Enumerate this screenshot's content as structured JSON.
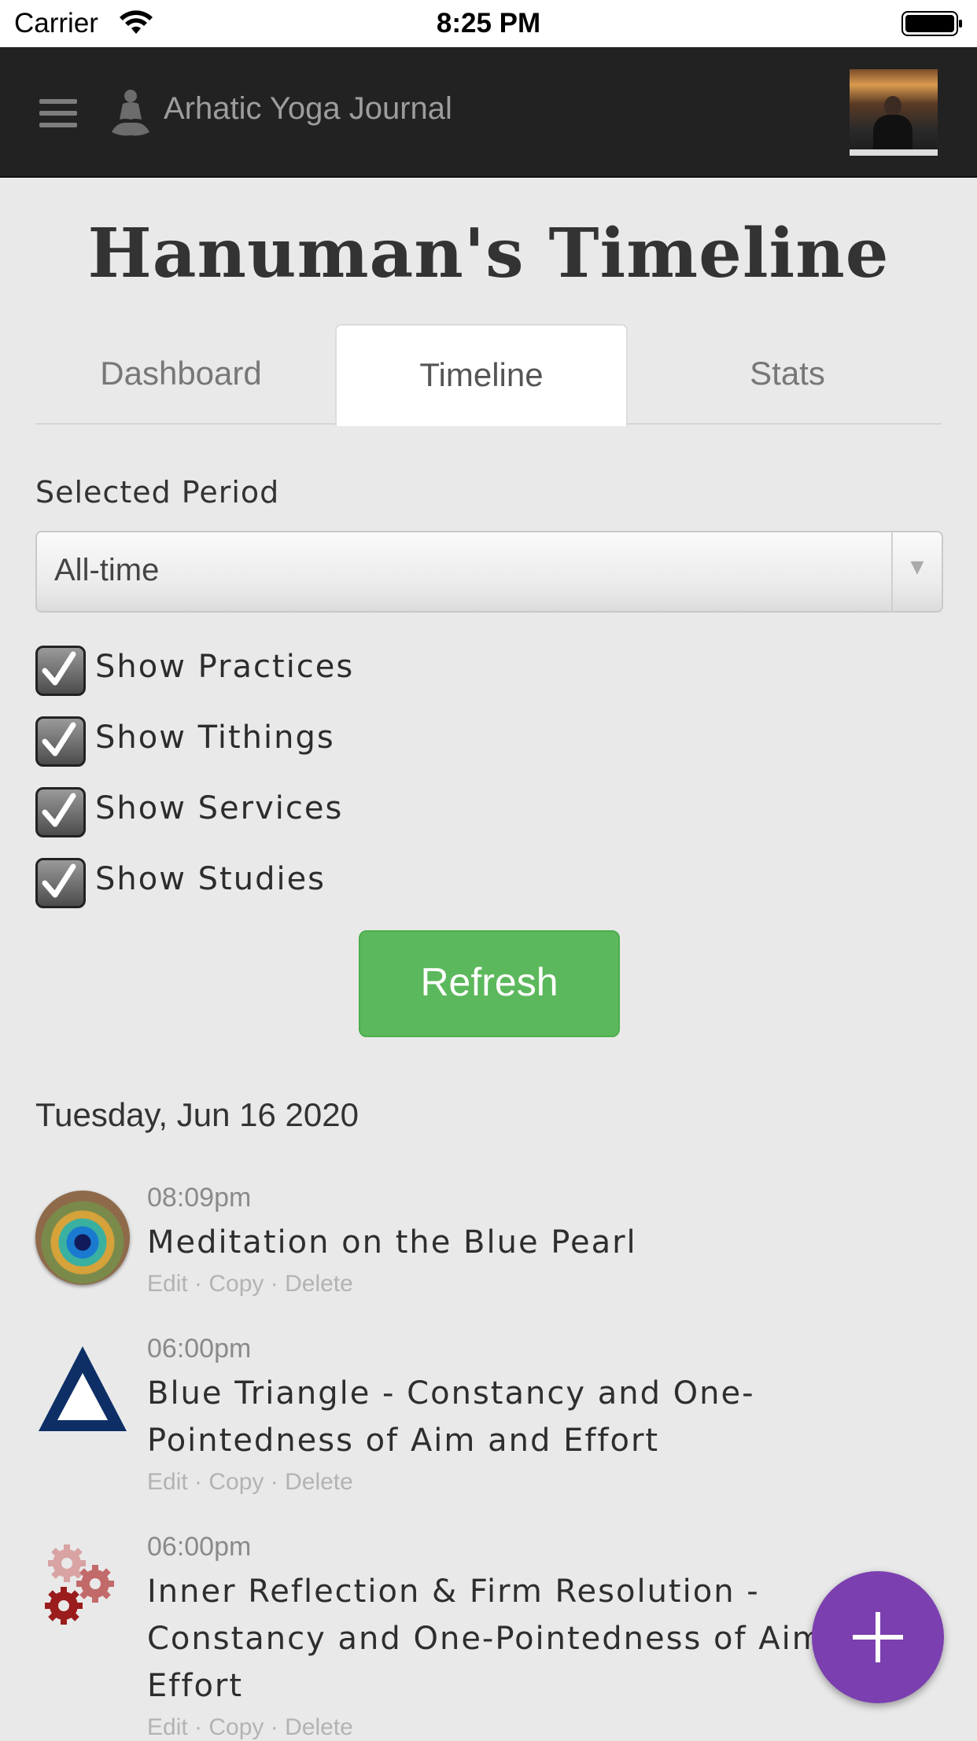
{
  "status_bar": {
    "carrier": "Carrier",
    "time": "8:25 PM"
  },
  "header": {
    "app_title": "Arhatic Yoga Journal"
  },
  "page": {
    "title": "Hanuman's Timeline"
  },
  "tabs": [
    {
      "label": "Dashboard",
      "active": false
    },
    {
      "label": "Timeline",
      "active": true
    },
    {
      "label": "Stats",
      "active": false
    }
  ],
  "filters": {
    "period_label": "Selected Period",
    "period_value": "All-time",
    "checkboxes": [
      {
        "label": "Show Practices",
        "checked": true
      },
      {
        "label": "Show Tithings",
        "checked": true
      },
      {
        "label": "Show Services",
        "checked": true
      },
      {
        "label": "Show Studies",
        "checked": true
      }
    ],
    "refresh_label": "Refresh"
  },
  "timeline": {
    "date": "Tuesday, Jun 16 2020",
    "actions": {
      "edit": "Edit",
      "copy": "Copy",
      "delete": "Delete",
      "separator": " · "
    },
    "entries": [
      {
        "time": "08:09pm",
        "title": "Meditation on the Blue Pearl",
        "icon": "peacock-feather-icon"
      },
      {
        "time": "06:00pm",
        "title": "Blue Triangle - Constancy and One-Pointedness of Aim and Effort",
        "icon": "blue-triangle-icon"
      },
      {
        "time": "06:00pm",
        "title": "Inner Reflection & Firm Resolution - Constancy and One-Pointedness of Aim and Effort",
        "icon": "gears-icon"
      }
    ]
  },
  "colors": {
    "navbar": "#222222",
    "refresh": "#5cb85c",
    "fab": "#7b3fb0",
    "triangle": "#0d2f66",
    "gear": "#9a1c1c"
  }
}
